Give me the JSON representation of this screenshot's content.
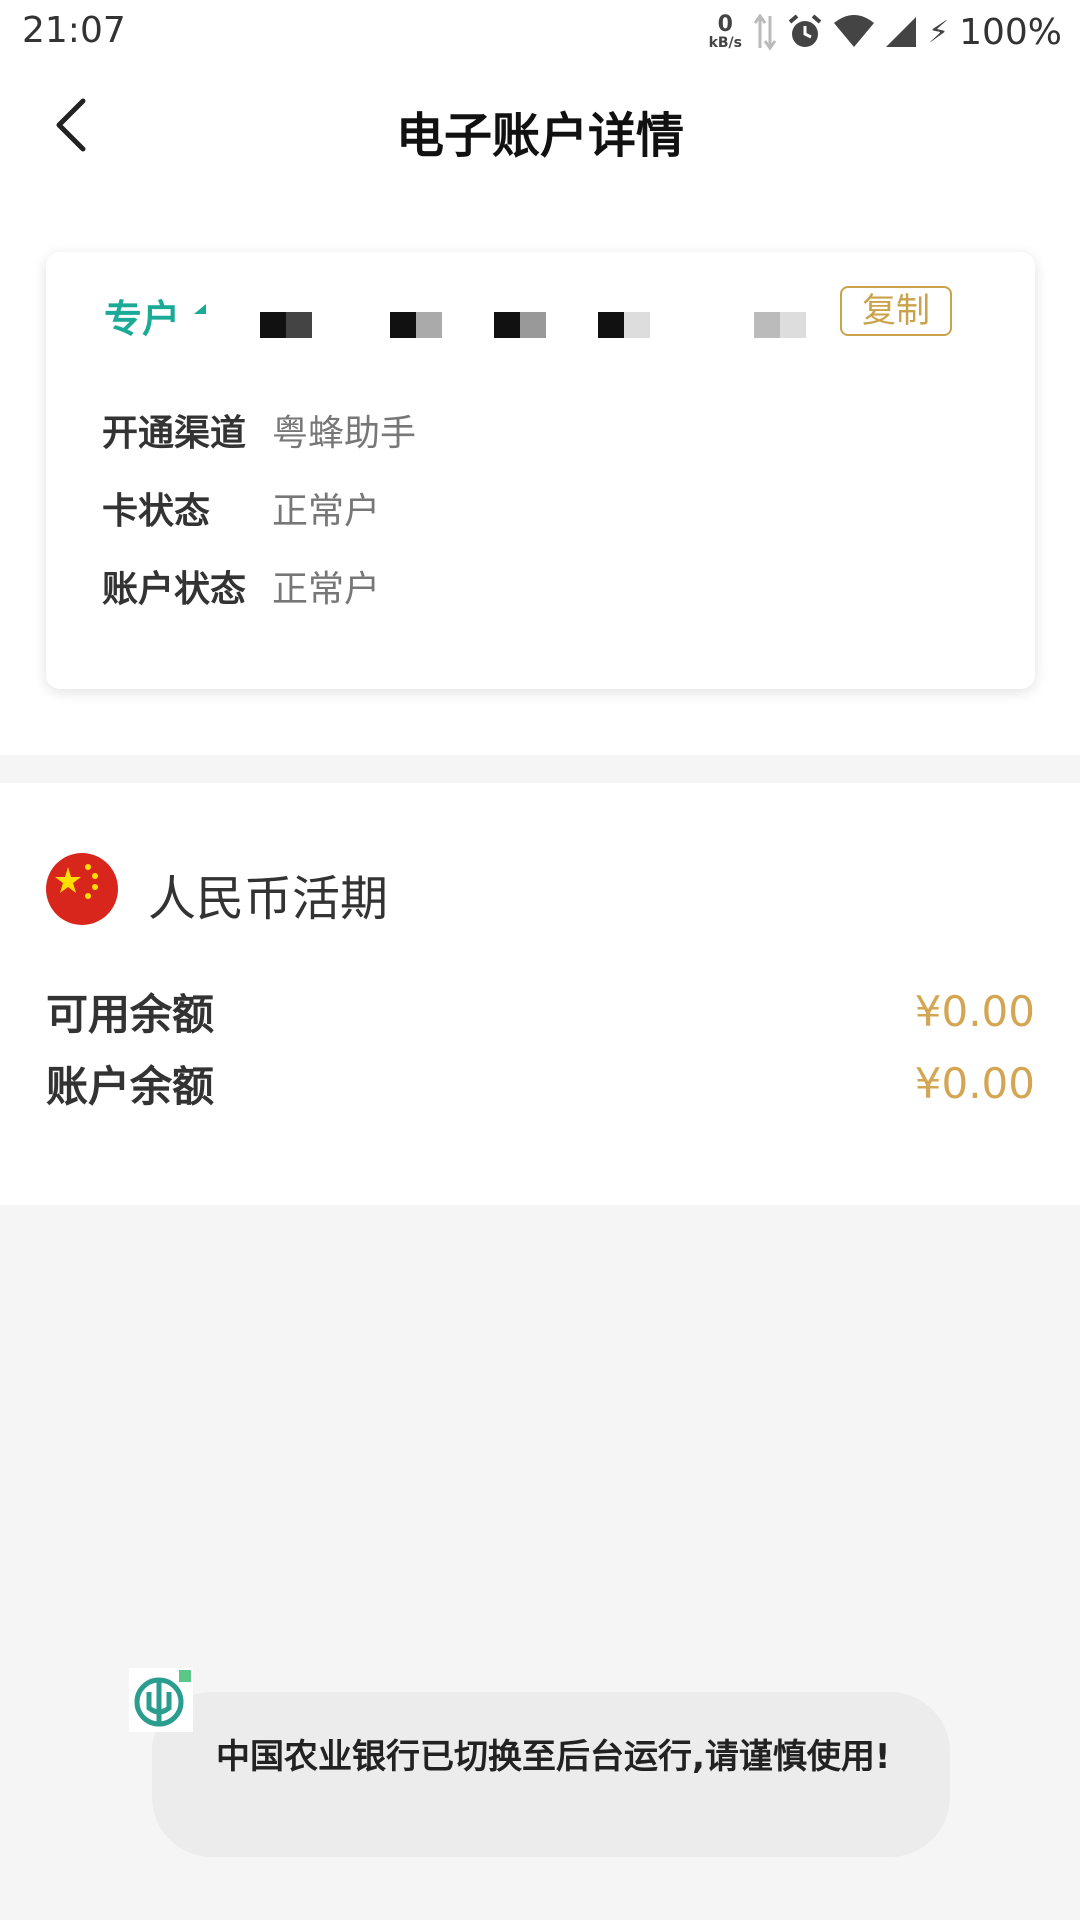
{
  "status_bar": {
    "time": "21:07",
    "net_speed_value": "0",
    "net_speed_unit": "kB/s",
    "battery": "100%",
    "icons": [
      "data-arrows-icon",
      "alarm-icon",
      "wifi-icon",
      "signal-icon",
      "charging-bolt-icon"
    ]
  },
  "header": {
    "back_icon": "chevron-left-icon",
    "title": "电子账户详情"
  },
  "account_card": {
    "type_label": "专户",
    "account_number_masked": true,
    "copy_label": "复制",
    "rows": [
      {
        "label": "开通渠道",
        "value": "粤蜂助手"
      },
      {
        "label": "卡状态",
        "value": "正常户"
      },
      {
        "label": "账户状态",
        "value": "正常户"
      }
    ]
  },
  "balance": {
    "flag_icon": "china-flag-icon",
    "currency_name": "人民币活期",
    "rows": [
      {
        "label": "可用余额",
        "value": "¥0.00"
      },
      {
        "label": "账户余额",
        "value": "¥0.00"
      }
    ]
  },
  "toast": {
    "logo_icon": "abc-bank-logo-icon",
    "message": "中国农业银行已切换至后台运行,请谨慎使用!"
  },
  "colors": {
    "accent_teal": "#1aaa96",
    "gold": "#d4a552",
    "copy_gold": "#c9a24a",
    "flag_red": "#d9261c",
    "page_bg": "#f5f5f5"
  }
}
